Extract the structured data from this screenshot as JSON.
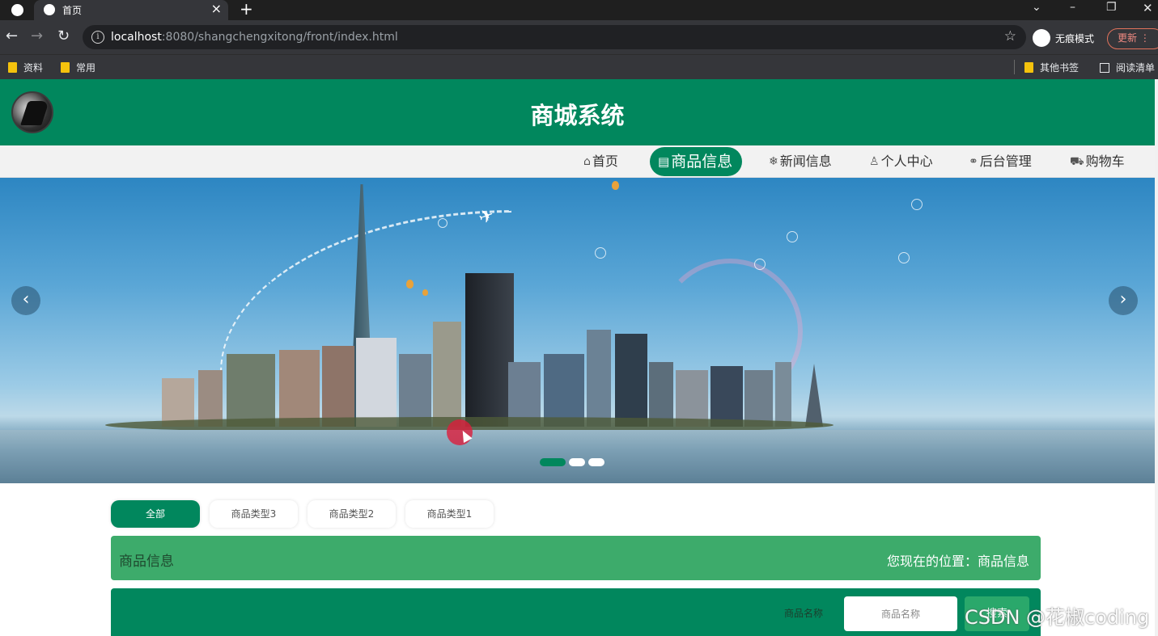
{
  "browser": {
    "tab_title": "首页",
    "url_host": "localhost",
    "url_rest": ":8080/shangchengxitong/front/index.html",
    "incognito_label": "无痕模式",
    "update_label": "更新",
    "bookmarks": [
      "资料",
      "常用"
    ],
    "other_bookmarks": "其他书签",
    "reading_list": "阅读清单"
  },
  "site": {
    "title": "商城系统",
    "nav": [
      {
        "label": "首页",
        "icon": "home-icon"
      },
      {
        "label": "商品信息",
        "icon": "goods-icon"
      },
      {
        "label": "新闻信息",
        "icon": "snowflake-icon"
      },
      {
        "label": "个人中心",
        "icon": "user-icon"
      },
      {
        "label": "后台管理",
        "icon": "link-icon"
      },
      {
        "label": "购物车",
        "icon": "cart-icon"
      }
    ],
    "active_nav": "商品信息",
    "accent_color": "#01875d"
  },
  "categories": [
    "全部",
    "商品类型3",
    "商品类型2",
    "商品类型1"
  ],
  "breadcrumb": {
    "title": "商品信息",
    "path": "您现在的位置：商品信息"
  },
  "search": {
    "label": "商品名称",
    "placeholder": "商品名称",
    "button": "搜索"
  },
  "watermark": "CSDN @花椒coding"
}
